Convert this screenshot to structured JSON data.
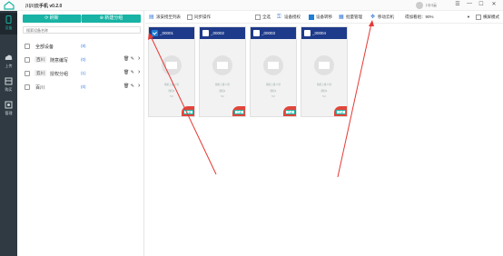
{
  "app": {
    "title": "川川云手机 v0.2.0",
    "username": "川川云"
  },
  "window_controls": [
    "☰",
    "—",
    "☐",
    "✕"
  ],
  "nav": [
    {
      "label": "设备",
      "icon": "phone-icon",
      "active": true
    },
    {
      "label": "上传",
      "icon": "cloud-upload-icon",
      "active": false
    },
    {
      "label": "购买",
      "icon": "cart-icon",
      "active": false
    },
    {
      "label": "管理",
      "icon": "settings-icon",
      "active": false
    }
  ],
  "left_panel": {
    "refresh_label": "刷新",
    "new_group_label": "新建分组",
    "search_placeholder": "搜索设备名称",
    "groups": [
      {
        "name": "全部设备",
        "count": "(8)",
        "tag": "",
        "has_actions": false
      },
      {
        "name": "随意编写",
        "count": "(0)",
        "tag": "百川",
        "has_actions": true
      },
      {
        "name": "授权分组",
        "count": "(1)",
        "tag": "云川",
        "has_actions": true
      },
      {
        "name": "百川",
        "count": "(0)",
        "tag": "",
        "has_actions": true
      }
    ]
  },
  "toolbar": {
    "screen_list": "滚安授至列表",
    "sync_ops": "同步操作",
    "select_all": "全选",
    "device_authorize": "设备授权",
    "device_transfer": "设备转移",
    "batch_manage": "批量管理",
    "move_device": "移动云机",
    "quality_select": "得加看组：90%",
    "landscape": "横屏模式"
  },
  "devices": [
    {
      "name": "_00001",
      "checked": true,
      "line1": "随机上级 0 秒",
      "line2": "随机4",
      "line3": "5:2",
      "badge": "云机"
    },
    {
      "name": "_00002",
      "checked": false,
      "line1": "随机上级 0 秒",
      "line2": "随机4",
      "line3": "5:2",
      "badge": "云机"
    },
    {
      "name": "_00003",
      "checked": false,
      "line1": "随机上级 0 秒",
      "line2": "随机4",
      "line3": "5:2",
      "badge": "云机"
    },
    {
      "name": "_00004",
      "checked": false,
      "line1": "随机上级 0 秒",
      "line2": "随机4",
      "line3": "5:2",
      "badge": "云机"
    }
  ],
  "colors": {
    "accent": "#18b3a4",
    "nav_bg": "#2f3a42",
    "device_header": "#1e3a8a",
    "checkbox_blue": "#1f7ed6",
    "annotation_arrow": "#e53935"
  }
}
